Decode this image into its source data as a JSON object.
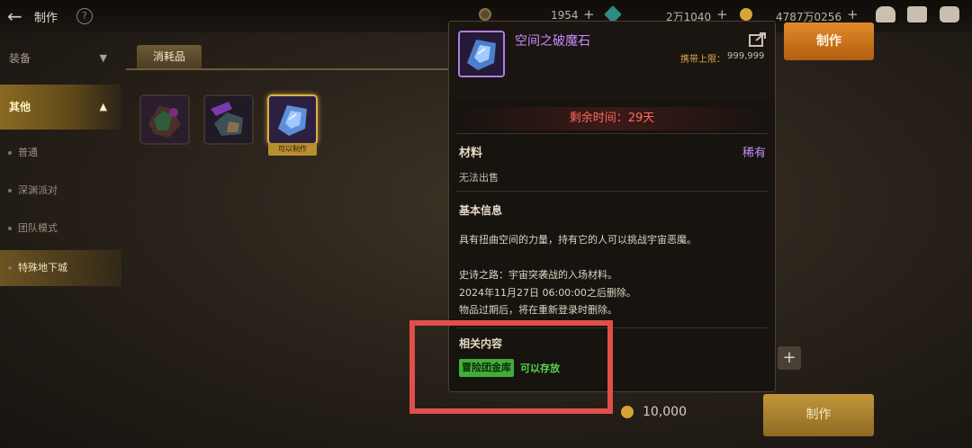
{
  "topbar": {
    "back_icon": "arrow-left-icon",
    "title": "制作",
    "help_icon": "question-circle-icon",
    "currencies": [
      {
        "icon": "coin-icon",
        "value": "1954",
        "color": "#c9a45a"
      },
      {
        "icon": "crystal-icon",
        "value": "2万1040",
        "color": "#3fb4a8"
      },
      {
        "icon": "gold-icon",
        "value": "4787万0256",
        "color": "#e0b23e"
      }
    ],
    "right_icons": [
      "chest-icon",
      "mail-icon",
      "chat-icon"
    ]
  },
  "sidebar": {
    "categories": [
      {
        "label": "装备",
        "chevron": "chevron-down-icon"
      },
      {
        "label": "其他",
        "chevron": "chevron-up-icon",
        "active": true
      }
    ],
    "subitems": [
      {
        "label": "普通"
      },
      {
        "label": "深渊派对"
      },
      {
        "label": "团队模式"
      },
      {
        "label": "特殊地下城",
        "active": true
      }
    ]
  },
  "tab": {
    "label": "消耗品"
  },
  "items": [
    {
      "icon": "dark-crystal-item-icon"
    },
    {
      "icon": "dark-stone-item-icon"
    },
    {
      "icon": "space-stone-item-icon",
      "tag": "可以制作",
      "selected": true
    }
  ],
  "tooltip": {
    "name": "空间之破魔石",
    "name_color": "#c58cff",
    "share_icon": "share-icon",
    "carry_label": "携带上限：",
    "carry_value": "999,999",
    "timer": "剩余时间：29天",
    "type": "材料",
    "rarity": "稀有",
    "trade": "无法出售",
    "basic_title": "基本信息",
    "desc": "具有扭曲空间的力量，持有它的人可以挑战宇宙恶魔。",
    "lines": [
      "史诗之路：宇宙突袭战的入场材料。",
      "2024年11月27日 06:00:00之后删除。",
      "物品过期后，将在重新登录时删除。"
    ],
    "related_title": "相关内容",
    "badge": "冒险团金库",
    "storage": "可以存放"
  },
  "craft_top": {
    "label": "制作"
  },
  "craft_bottom": {
    "label": "制作"
  },
  "plus_label": "+",
  "price": {
    "icon": "gold-coin-icon",
    "value": "10,000"
  }
}
